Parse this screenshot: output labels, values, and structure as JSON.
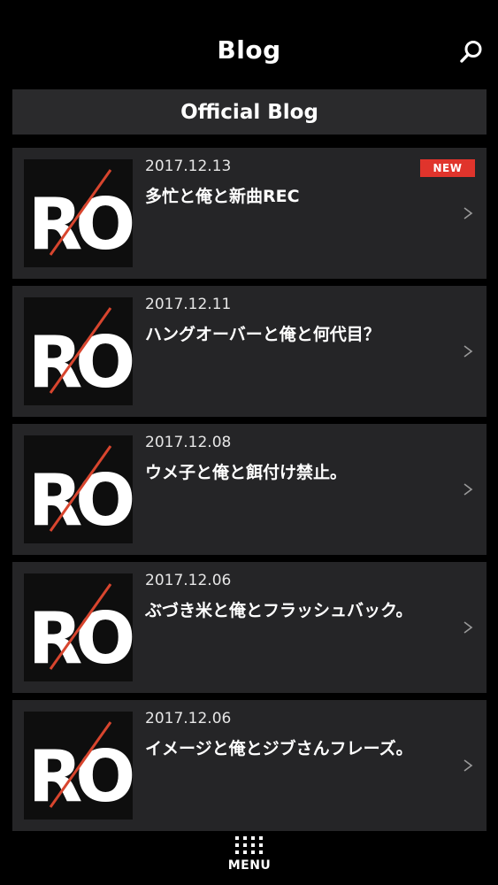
{
  "header": {
    "title": "Blog",
    "search_icon": "search-icon"
  },
  "section": {
    "title": "Official Blog"
  },
  "posts": [
    {
      "date": "2017.12.13",
      "title": "多忙と俺と新曲REC",
      "badge": "NEW",
      "thumbnail_text": "RO"
    },
    {
      "date": "2017.12.11",
      "title": "ハングオーバーと俺と何代目？",
      "thumbnail_text": "RO"
    },
    {
      "date": "2017.12.08",
      "title": "ウメ子と俺と餌付け禁止。",
      "thumbnail_text": "RO"
    },
    {
      "date": "2017.12.06",
      "title": "ぶづき米と俺とフラッシュバック。",
      "thumbnail_text": "RO"
    },
    {
      "date": "2017.12.06",
      "title": "イメージと俺とジブさんフレーズ。",
      "thumbnail_text": "RO"
    }
  ],
  "footer": {
    "menu_label": "MENU",
    "menu_icon": "grid-icon"
  },
  "colors": {
    "background": "#000000",
    "card": "#252527",
    "section_bar": "#2a2a2c",
    "badge": "#e0342c",
    "logo_slash": "#d8452e"
  }
}
